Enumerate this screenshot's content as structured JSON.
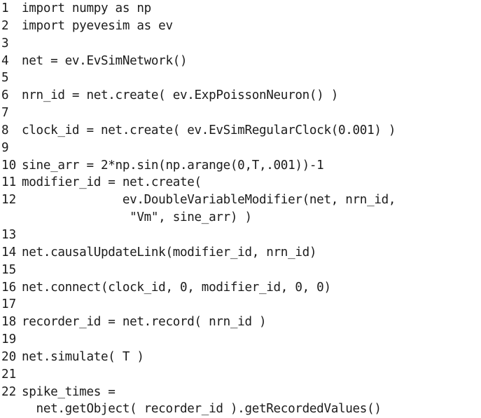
{
  "document": {
    "kind": "code-listing",
    "language": "Python",
    "background_color": "#ffffff",
    "text_color": "#1c1c1c",
    "line_count": 22,
    "lines": [
      {
        "number": "1",
        "code": "import numpy as np"
      },
      {
        "number": "2",
        "code": "import pyevesim as ev"
      },
      {
        "number": "3",
        "code": ""
      },
      {
        "number": "4",
        "code": "net = ev.EvSimNetwork()"
      },
      {
        "number": "5",
        "code": ""
      },
      {
        "number": "6",
        "code": "nrn_id = net.create( ev.ExpPoissonNeuron() )"
      },
      {
        "number": "7",
        "code": ""
      },
      {
        "number": "8",
        "code": "clock_id = net.create( ev.EvSimRegularClock(0.001) )"
      },
      {
        "number": "9",
        "code": ""
      },
      {
        "number": "10",
        "code": "sine_arr = 2*np.sin(np.arange(0,T,.001))-1"
      },
      {
        "number": "11",
        "code": "modifier_id = net.create("
      },
      {
        "number": "12",
        "code": "              ev.DoubleVariableModifier(net, nrn_id,"
      },
      {
        "number": "",
        "code": "               \"Vm\", sine_arr) )"
      },
      {
        "number": "13",
        "code": ""
      },
      {
        "number": "14",
        "code": "net.causalUpdateLink(modifier_id, nrn_id)"
      },
      {
        "number": "15",
        "code": ""
      },
      {
        "number": "16",
        "code": "net.connect(clock_id, 0, modifier_id, 0, 0)"
      },
      {
        "number": "17",
        "code": ""
      },
      {
        "number": "18",
        "code": "recorder_id = net.record( nrn_id )"
      },
      {
        "number": "19",
        "code": ""
      },
      {
        "number": "20",
        "code": "net.simulate( T )"
      },
      {
        "number": "21",
        "code": ""
      },
      {
        "number": "22",
        "code": "spike_times ="
      },
      {
        "number": "",
        "code": "  net.getObject( recorder_id ).getRecordedValues()"
      }
    ]
  }
}
